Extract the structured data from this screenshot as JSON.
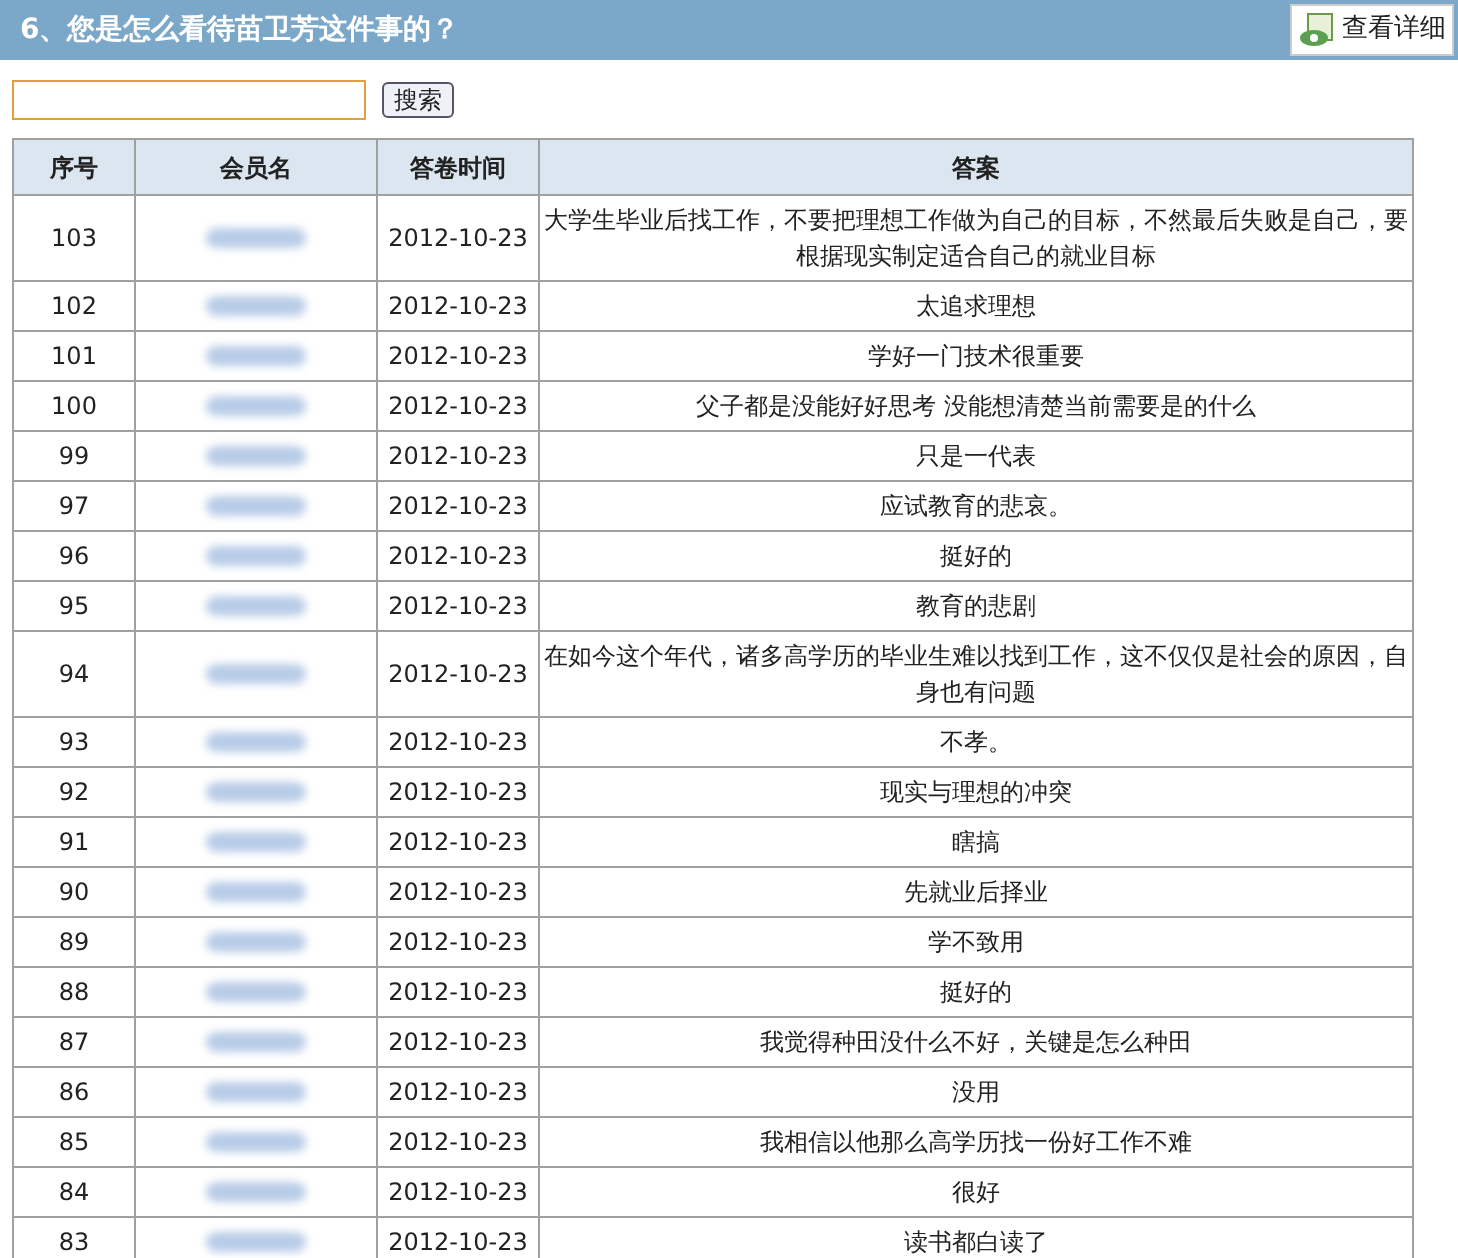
{
  "header": {
    "title": "6、您是怎么看待苗卫芳这件事的？",
    "detail_button": "查看详细"
  },
  "search": {
    "button": "搜索"
  },
  "table": {
    "columns": [
      "序号",
      "会员名",
      "答卷时间",
      "答案"
    ],
    "rows": [
      {
        "no": "103",
        "time": "2012-10-23",
        "answer": "大学生毕业后找工作，不要把理想工作做为自己的目标，不然最后失败是自己，要根据现实制定适合自己的就业目标"
      },
      {
        "no": "102",
        "time": "2012-10-23",
        "answer": "太追求理想"
      },
      {
        "no": "101",
        "time": "2012-10-23",
        "answer": "学好一门技术很重要"
      },
      {
        "no": "100",
        "time": "2012-10-23",
        "answer": "父子都是没能好好思考 没能想清楚当前需要是的什么"
      },
      {
        "no": "99",
        "time": "2012-10-23",
        "answer": "只是一代表"
      },
      {
        "no": "97",
        "time": "2012-10-23",
        "answer": "应试教育的悲哀。"
      },
      {
        "no": "96",
        "time": "2012-10-23",
        "answer": "挺好的"
      },
      {
        "no": "95",
        "time": "2012-10-23",
        "answer": "教育的悲剧"
      },
      {
        "no": "94",
        "time": "2012-10-23",
        "answer": "在如今这个年代，诸多高学历的毕业生难以找到工作，这不仅仅是社会的原因，自身也有问题"
      },
      {
        "no": "93",
        "time": "2012-10-23",
        "answer": "不孝。"
      },
      {
        "no": "92",
        "time": "2012-10-23",
        "answer": "现实与理想的冲突"
      },
      {
        "no": "91",
        "time": "2012-10-23",
        "answer": "瞎搞"
      },
      {
        "no": "90",
        "time": "2012-10-23",
        "answer": "先就业后择业"
      },
      {
        "no": "89",
        "time": "2012-10-23",
        "answer": "学不致用"
      },
      {
        "no": "88",
        "time": "2012-10-23",
        "answer": "挺好的"
      },
      {
        "no": "87",
        "time": "2012-10-23",
        "answer": "我觉得种田没什么不好，关键是怎么种田"
      },
      {
        "no": "86",
        "time": "2012-10-23",
        "answer": "没用"
      },
      {
        "no": "85",
        "time": "2012-10-23",
        "answer": "我相信以他那么高学历找一份好工作不难"
      },
      {
        "no": "84",
        "time": "2012-10-23",
        "answer": "很好"
      },
      {
        "no": "83",
        "time": "2012-10-23",
        "answer": "读书都白读了"
      }
    ]
  }
}
